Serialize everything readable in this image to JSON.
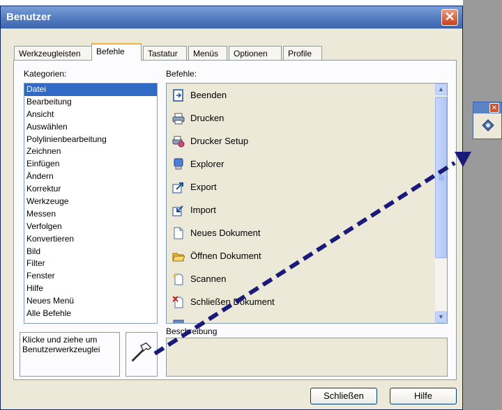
{
  "dialog": {
    "title": "Benutzer",
    "close_glyph": "✕"
  },
  "tabs": [
    {
      "label": "Werkzeugleisten",
      "active": false
    },
    {
      "label": "Befehle",
      "active": true
    },
    {
      "label": "Tastatur",
      "active": false
    },
    {
      "label": "Menüs",
      "active": false
    },
    {
      "label": "Optionen",
      "active": false
    },
    {
      "label": "Profile",
      "active": false
    }
  ],
  "categories": {
    "label": "Kategorien:",
    "selected": "Datei",
    "items": [
      "Datei",
      "Bearbeitung",
      "Ansicht",
      "Auswählen",
      "Polylinienbearbeitung",
      "Zeichnen",
      "Einfügen",
      "Ändern",
      "Korrektur",
      "Werkzeuge",
      "Messen",
      "Verfolgen",
      "Konvertieren",
      "Bild",
      "Filter",
      "Fenster",
      "Hilfe",
      "Neues Menü",
      "Alle Befehle"
    ]
  },
  "commands": {
    "label": "Befehle:",
    "items": [
      {
        "label": "Beenden",
        "icon": "exit-icon"
      },
      {
        "label": "Drucken",
        "icon": "print-icon"
      },
      {
        "label": "Drucker Setup",
        "icon": "printer-setup-icon"
      },
      {
        "label": "Explorer",
        "icon": "explorer-icon"
      },
      {
        "label": "Export",
        "icon": "export-icon"
      },
      {
        "label": "Import",
        "icon": "import-icon"
      },
      {
        "label": "Neues Dokument",
        "icon": "new-document-icon"
      },
      {
        "label": "Öffnen Dokument",
        "icon": "open-folder-icon"
      },
      {
        "label": "Scannen",
        "icon": "scan-icon"
      },
      {
        "label": "Schließen Dokument",
        "icon": "close-document-icon"
      }
    ]
  },
  "hint": {
    "text": "Klicke und ziehe um Benutzerwerkzeuglei"
  },
  "description": {
    "label": "Beschreibung"
  },
  "buttons": {
    "close": "Schließen",
    "help": "Hilfe"
  },
  "floating_toolbar": {
    "close_glyph": "✕",
    "tool_icon": "custom-tool-icon"
  },
  "colors": {
    "selection": "#316ac5",
    "titlebar": "#3c64b0",
    "dialog_face": "#ece9d8",
    "arrow": "#1a1a7a"
  }
}
